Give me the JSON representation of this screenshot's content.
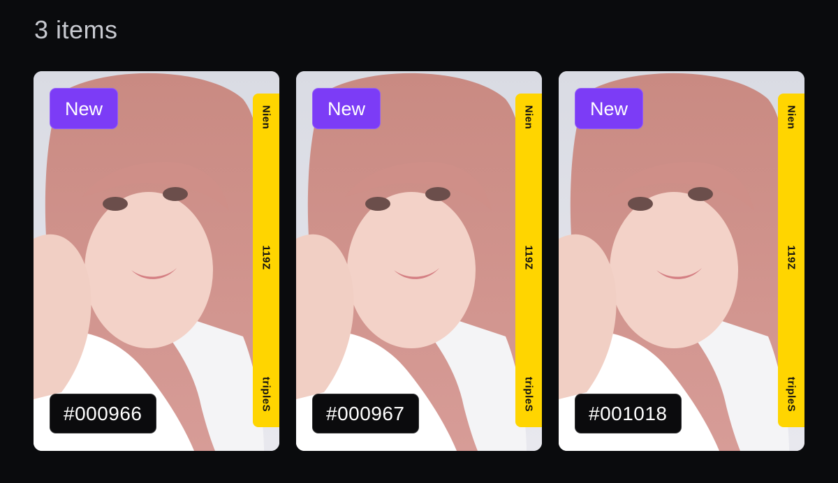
{
  "header": {
    "count_label": "3 items"
  },
  "cards": [
    {
      "badge": "New",
      "serial": "#000966",
      "member": "Nien",
      "season": "119Z",
      "group": "tripleS"
    },
    {
      "badge": "New",
      "serial": "#000967",
      "member": "Nien",
      "season": "119Z",
      "group": "tripleS"
    },
    {
      "badge": "New",
      "serial": "#001018",
      "member": "Nien",
      "season": "119Z",
      "group": "tripleS"
    }
  ],
  "colors": {
    "background": "#0a0b0d",
    "badge_new": "#7c3cf6",
    "band": "#ffd500",
    "serial_bg": "#0b0b0d"
  }
}
